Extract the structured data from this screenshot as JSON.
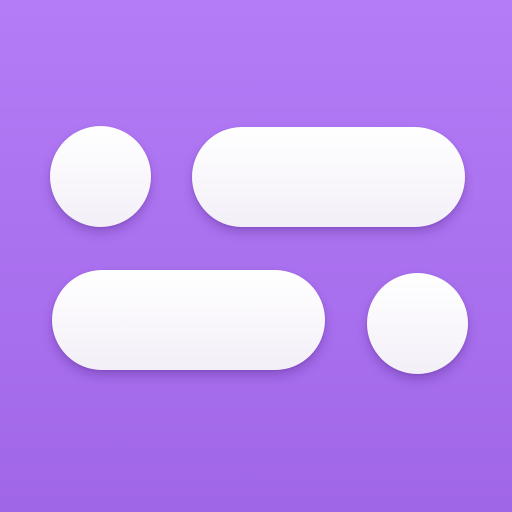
{
  "icon": {
    "name": "toggle-pills-icon",
    "colors": {
      "background_top": "#b47cf6",
      "background_bottom": "#a066e8",
      "shape_fill": "#f7f4fa"
    }
  }
}
